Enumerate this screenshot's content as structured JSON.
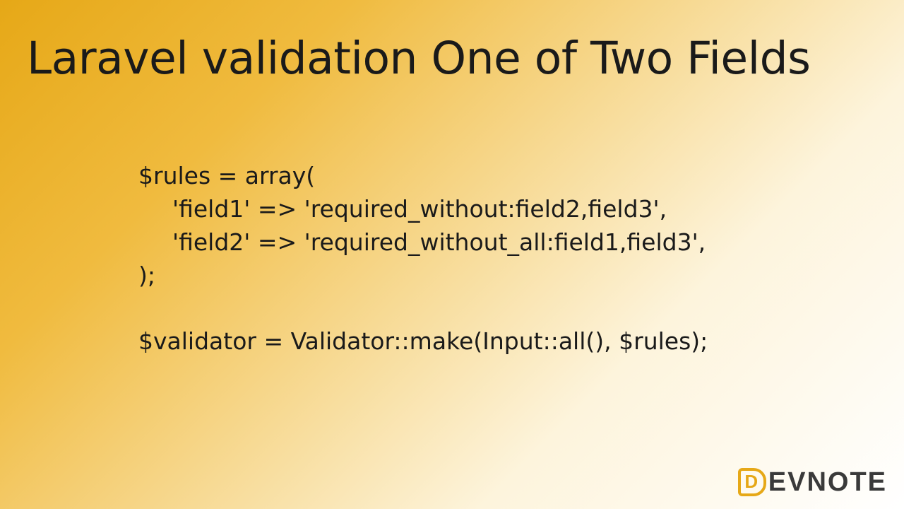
{
  "title": "Laravel validation One of Two Fields",
  "code": {
    "line1": "$rules = array(",
    "line2": "'field1' => 'required_without:field2,field3',",
    "line3": "'field2' => 'required_without_all:field1,field3',",
    "line4": ");",
    "line5": "$validator = Validator::make(Input::all(), $rules);"
  },
  "logo": {
    "d": "D",
    "text": "EVNOTE"
  }
}
